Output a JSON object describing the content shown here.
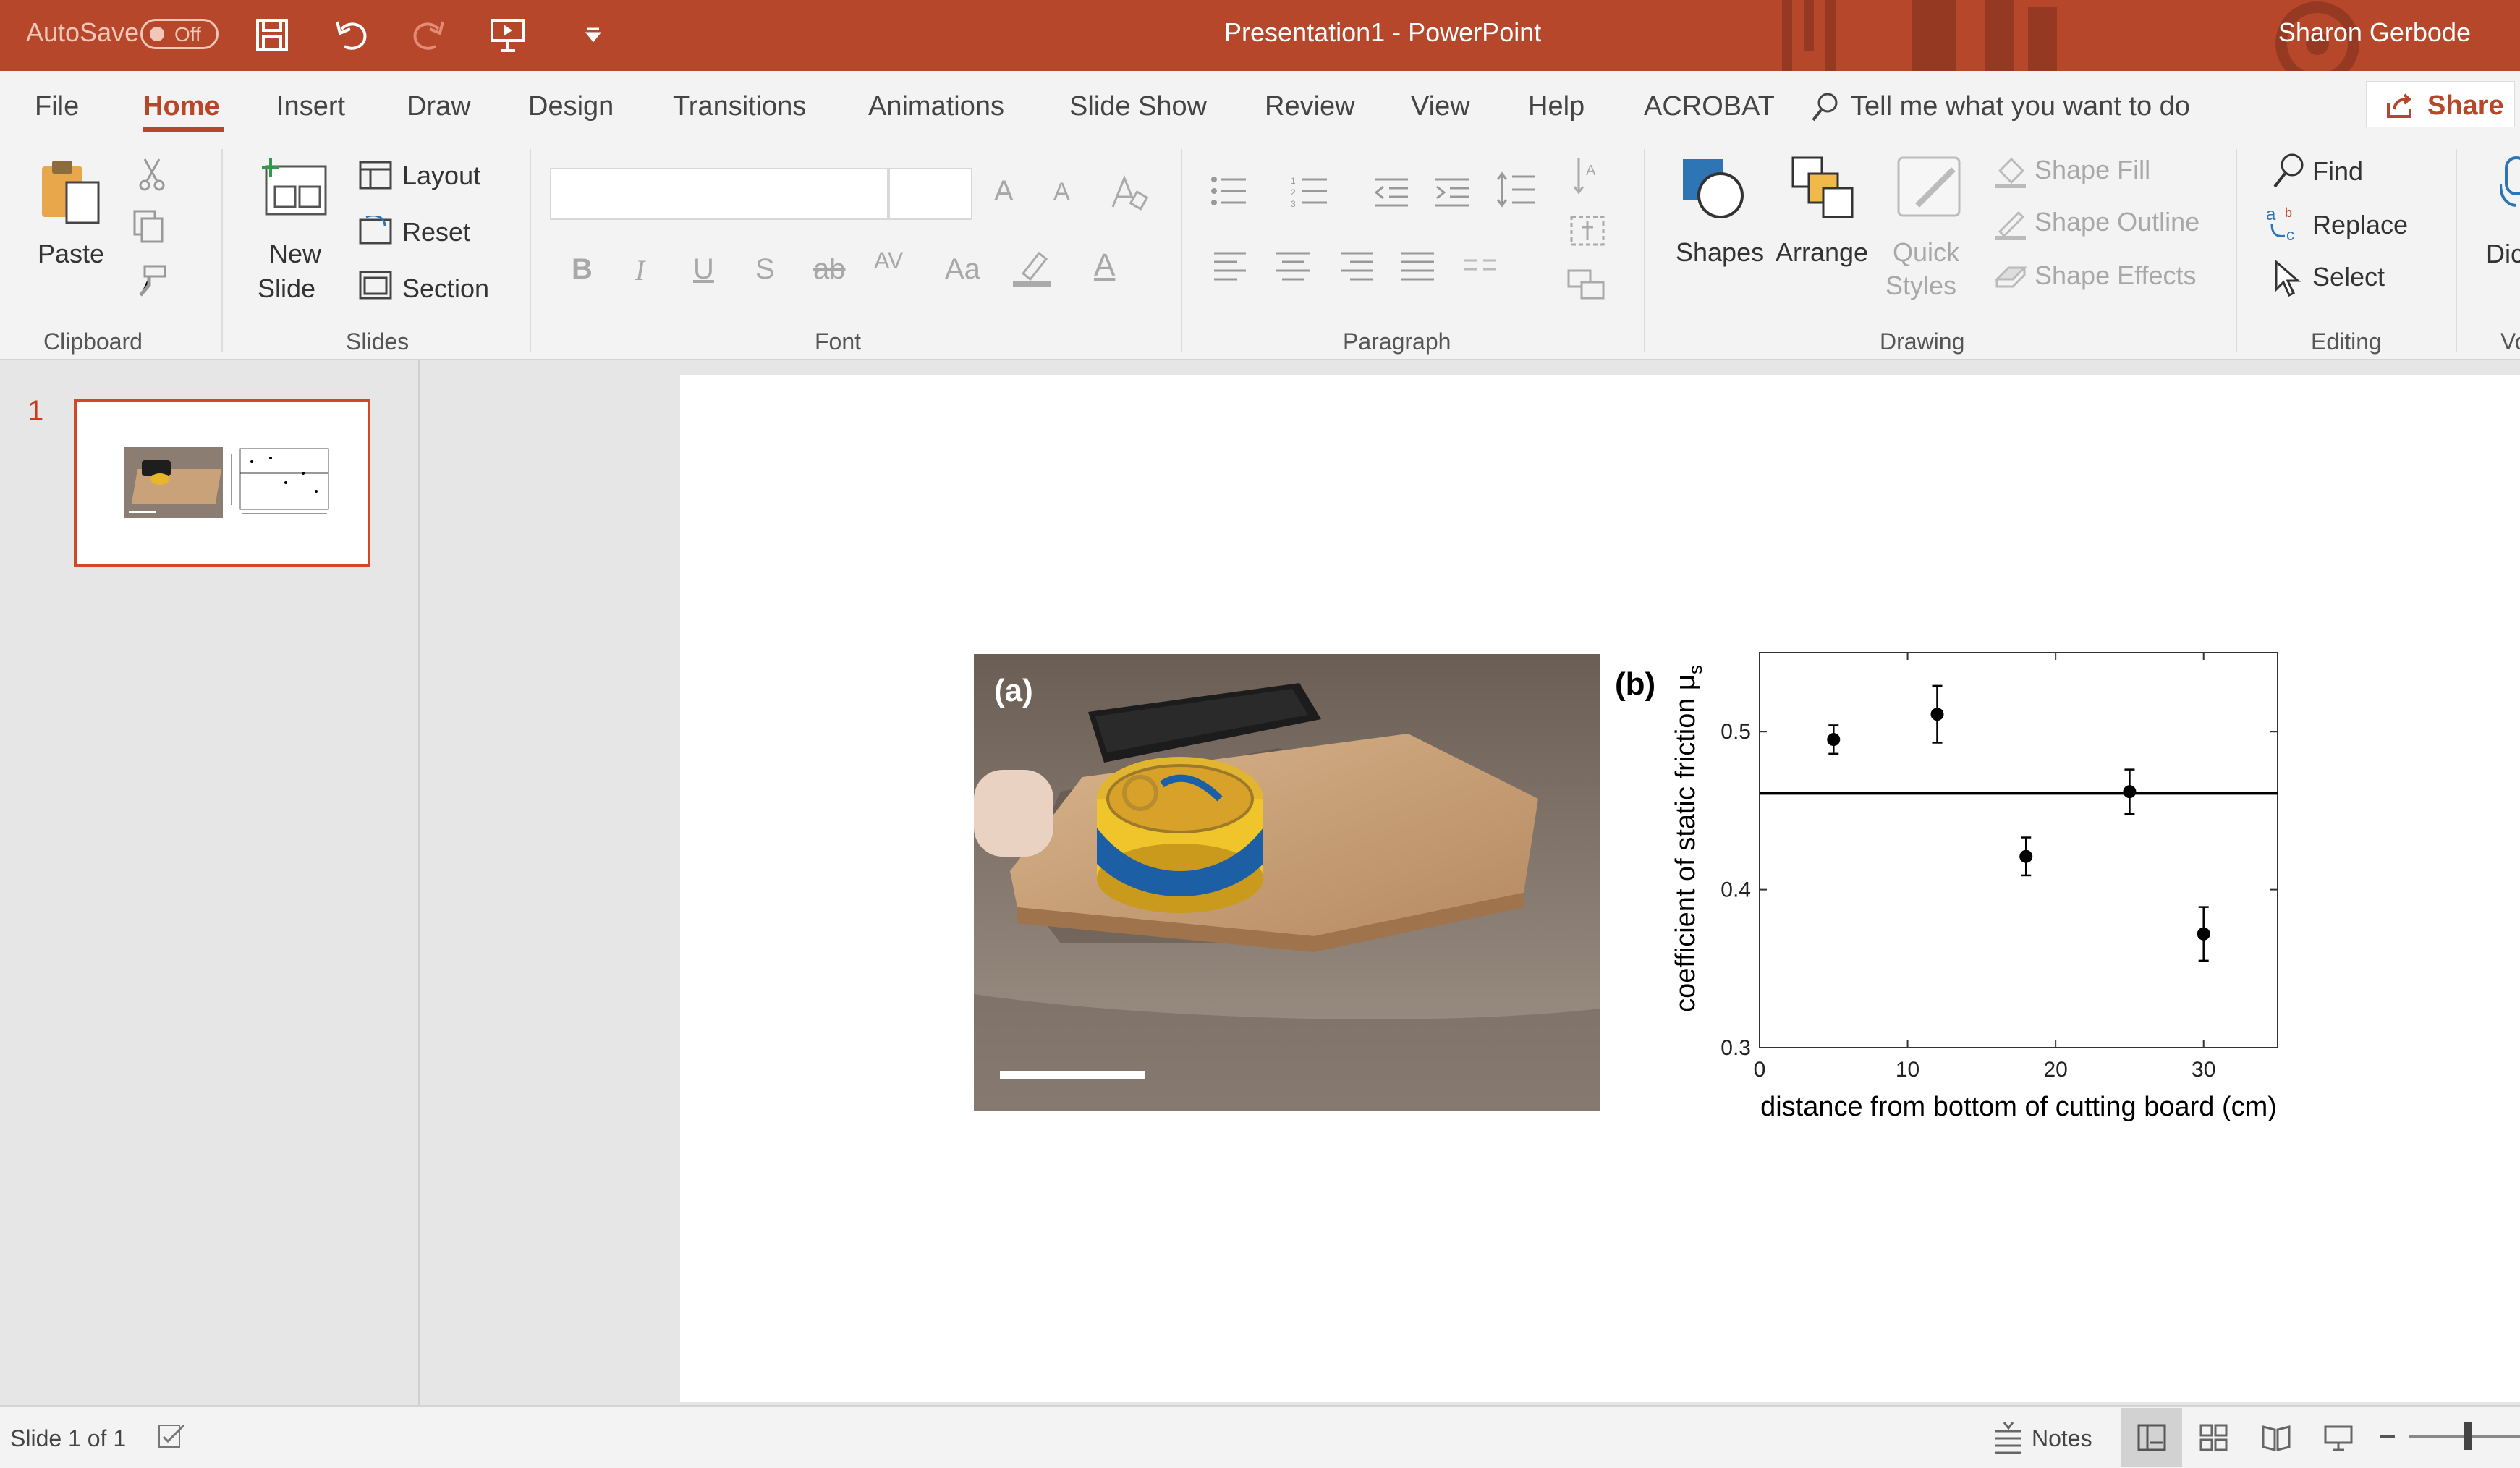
{
  "titlebar": {
    "autosave_label": "AutoSave",
    "autosave_state": "Off",
    "document_title": "Presentation1  -  PowerPoint",
    "user_name": "Sharon Gerbode",
    "accent_color": "#b7472a"
  },
  "menu": {
    "tabs": [
      "File",
      "Home",
      "Insert",
      "Draw",
      "Design",
      "Transitions",
      "Animations",
      "Slide Show",
      "Review",
      "View",
      "Help",
      "ACROBAT"
    ],
    "active_tab": "Home",
    "tell_me": "Tell me what you want to do",
    "share_label": "Share"
  },
  "ribbon": {
    "clipboard": {
      "paste": "Paste",
      "label": "Clipboard"
    },
    "slides": {
      "new_slide_1": "New",
      "new_slide_2": "Slide",
      "layout": "Layout",
      "reset": "Reset",
      "section": "Section",
      "label": "Slides"
    },
    "font": {
      "label": "Font",
      "grow": "A",
      "shrink": "A",
      "bold": "B",
      "italic": "I",
      "underline": "U",
      "shadow": "S",
      "strike": "ab",
      "spacing": "AV",
      "case": "Aa",
      "color": "A"
    },
    "paragraph": {
      "label": "Paragraph"
    },
    "drawing": {
      "shapes": "Shapes",
      "arrange": "Arrange",
      "quick_styles_1": "Quick",
      "quick_styles_2": "Styles",
      "shape_fill": "Shape Fill",
      "shape_outline": "Shape Outline",
      "shape_effects": "Shape Effects",
      "label": "Drawing"
    },
    "editing": {
      "find": "Find",
      "replace": "Replace",
      "select": "Select",
      "label": "Editing"
    },
    "partial_1": "Dic",
    "partial_2": "Vo"
  },
  "slides_panel": {
    "slide_number": "1"
  },
  "slide": {
    "photo_label": "(a)",
    "chart_label": "(b)"
  },
  "chart_data": {
    "type": "scatter",
    "xlabel": "distance from bottom of cutting board (cm)",
    "ylabel": "coefficient of static friction μ",
    "ylabel_sub": "s",
    "xlim": [
      0,
      35
    ],
    "ylim": [
      0.3,
      0.55
    ],
    "xticks": [
      0,
      10,
      20,
      30
    ],
    "yticks": [
      0.3,
      0.4,
      0.5
    ],
    "points": [
      {
        "x": 5,
        "y": 0.495,
        "err": 0.009
      },
      {
        "x": 12,
        "y": 0.511,
        "err": 0.018
      },
      {
        "x": 18,
        "y": 0.421,
        "err": 0.012
      },
      {
        "x": 25,
        "y": 0.462,
        "err": 0.014
      },
      {
        "x": 30,
        "y": 0.372,
        "err": 0.017
      }
    ],
    "horizontal_line": 0.461
  },
  "statusbar": {
    "slide_info": "Slide 1 of 1",
    "notes": "Notes"
  }
}
